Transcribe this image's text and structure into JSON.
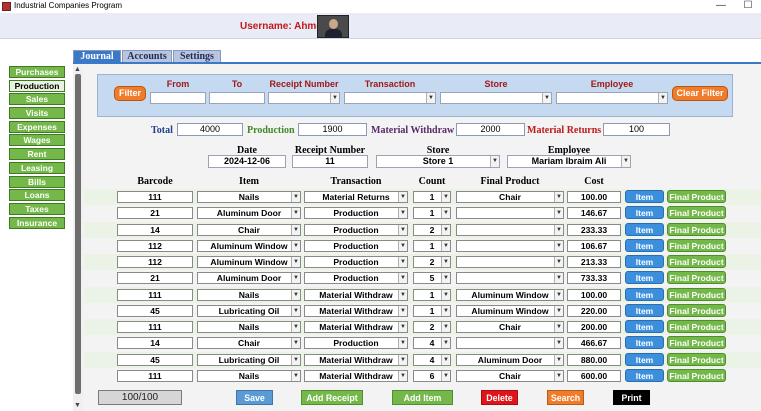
{
  "window": {
    "title": "Industrial Companies Program",
    "minimize": "—",
    "maximize": "☐"
  },
  "header": {
    "username": "Username: Ahmed"
  },
  "menu": [
    "Purchases",
    "Production",
    "Sales",
    "Visits",
    "Expenses",
    "Wages",
    "Rent",
    "Leasing",
    "Bills",
    "Loans",
    "Taxes",
    "Insurance"
  ],
  "menu_active": "Production",
  "tabs": [
    "Journal",
    "Accounts",
    "Settings"
  ],
  "tab_active": "Journal",
  "filter": {
    "filter_button": "Filter",
    "clear_button": "Clear Filter",
    "labels": {
      "from": "From",
      "to": "To",
      "receipt": "Receipt Number",
      "transaction": "Transaction",
      "store": "Store",
      "employee": "Employee"
    }
  },
  "totals": {
    "total_label": "Total",
    "total_value": "4000",
    "production_label": "Production",
    "production_value": "1900",
    "withdraw_label": "Material Withdraw",
    "withdraw_value": "2000",
    "returns_label": "Material Returns",
    "returns_value": "100"
  },
  "form": {
    "date_label": "Date",
    "date_value": "2024-12-06",
    "receipt_label": "Receipt Number",
    "receipt_value": "11",
    "store_label": "Store",
    "store_value": "Store 1",
    "employee_label": "Employee",
    "employee_value": "Mariam Ibraim Ali"
  },
  "table": {
    "headers": {
      "barcode": "Barcode",
      "item": "Item",
      "transaction": "Transaction",
      "count": "Count",
      "final_product": "Final Product",
      "cost": "Cost"
    },
    "rows": [
      {
        "barcode": "111",
        "item": "Nails",
        "transaction": "Material Returns",
        "count": "1",
        "final_product": "Chair",
        "cost": "100.00"
      },
      {
        "barcode": "21",
        "item": "Aluminum Door",
        "transaction": "Production",
        "count": "1",
        "final_product": "",
        "cost": "146.67"
      },
      {
        "barcode": "14",
        "item": "Chair",
        "transaction": "Production",
        "count": "2",
        "final_product": "",
        "cost": "233.33"
      },
      {
        "barcode": "112",
        "item": "Aluminum Window",
        "transaction": "Production",
        "count": "1",
        "final_product": "",
        "cost": "106.67"
      },
      {
        "barcode": "112",
        "item": "Aluminum Window",
        "transaction": "Production",
        "count": "2",
        "final_product": "",
        "cost": "213.33"
      },
      {
        "barcode": "21",
        "item": "Aluminum Door",
        "transaction": "Production",
        "count": "5",
        "final_product": "",
        "cost": "733.33"
      },
      {
        "barcode": "111",
        "item": "Nails",
        "transaction": "Material Withdraw",
        "count": "1",
        "final_product": "Aluminum Window",
        "cost": "100.00"
      },
      {
        "barcode": "45",
        "item": "Lubricating Oil",
        "transaction": "Material Withdraw",
        "count": "1",
        "final_product": "Aluminum Window",
        "cost": "220.00"
      },
      {
        "barcode": "111",
        "item": "Nails",
        "transaction": "Material Withdraw",
        "count": "2",
        "final_product": "Chair",
        "cost": "200.00"
      },
      {
        "barcode": "14",
        "item": "Chair",
        "transaction": "Production",
        "count": "4",
        "final_product": "",
        "cost": "466.67"
      },
      {
        "barcode": "45",
        "item": "Lubricating Oil",
        "transaction": "Material Withdraw",
        "count": "4",
        "final_product": "Aluminum Door",
        "cost": "880.00"
      },
      {
        "barcode": "111",
        "item": "Nails",
        "transaction": "Material Withdraw",
        "count": "6",
        "final_product": "Chair",
        "cost": "600.00"
      }
    ],
    "item_button": "Item",
    "final_product_button": "Final Product"
  },
  "footer": {
    "record_counter": "100/100",
    "save": "Save",
    "add_receipt": "Add Receipt",
    "add_item": "Add Item",
    "delete": "Delete",
    "search": "Search",
    "print": "Print"
  },
  "colors": {
    "menu_green": "#74b84a",
    "tab_blue": "#3a78c8",
    "filter_bg": "#c5daf0",
    "orange": "#f07c2a",
    "item_blue": "#3c8fdc",
    "delete_red": "#e0151b",
    "total_label": "#1f3f8a",
    "production_label": "#3f8a2a",
    "withdraw_label": "#5a2a6a",
    "returns_label": "#c0181a"
  }
}
